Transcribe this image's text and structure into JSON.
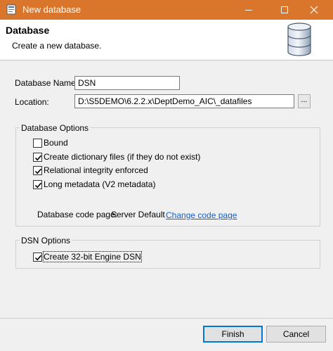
{
  "window": {
    "title": "New database"
  },
  "banner": {
    "title": "Database",
    "description": "Create a new database."
  },
  "fields": {
    "name_label": "Database Name:",
    "name_value": "DSN",
    "location_label": "Location:",
    "location_value": "D:\\S5DEMO\\6.2.2.x\\DeptDemo_AIC\\_datafiles",
    "browse_label": "..."
  },
  "database_options": {
    "legend": "Database Options",
    "options": [
      {
        "label": "Bound",
        "checked": false
      },
      {
        "label": "Create dictionary files (if they do not exist)",
        "checked": true
      },
      {
        "label": "Relational integrity enforced",
        "checked": true
      },
      {
        "label": "Long metadata (V2 metadata)",
        "checked": true
      }
    ],
    "code_page_label": "Database code page:",
    "code_page_value": "Server Default",
    "change_code_page_link": "Change code page"
  },
  "dsn_options": {
    "legend": "DSN Options",
    "option": {
      "label": "Create 32-bit Engine DSN",
      "checked": true
    }
  },
  "buttons": {
    "finish": "Finish",
    "cancel": "Cancel"
  },
  "colors": {
    "title_bar": "#d9762c",
    "link": "#1a5ecb",
    "default_button_border": "#0078d7"
  }
}
